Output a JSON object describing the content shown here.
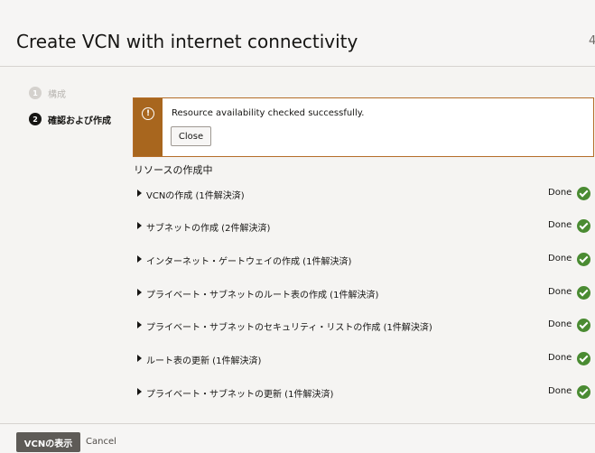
{
  "header": {
    "title": "Create VCN with internet connectivity",
    "cut_text": "4"
  },
  "steps": [
    {
      "number": "1",
      "label": "構成"
    },
    {
      "number": "2",
      "label": "確認および作成"
    }
  ],
  "alert": {
    "icon": "!",
    "message": "Resource availability checked successfully.",
    "close_label": "Close"
  },
  "section": {
    "title": "リソースの作成中"
  },
  "tasks": [
    {
      "name": "VCNの作成 (1件解決済)",
      "status": "Done"
    },
    {
      "name": "サブネットの作成 (2件解決済)",
      "status": "Done"
    },
    {
      "name": "インターネット・ゲートウェイの作成 (1件解決済)",
      "status": "Done"
    },
    {
      "name": "プライベート・サブネットのルート表の作成 (1件解決済)",
      "status": "Done"
    },
    {
      "name": "プライベート・サブネットのセキュリティ・リストの作成 (1件解決済)",
      "status": "Done"
    },
    {
      "name": "ルート表の更新 (1件解決済)",
      "status": "Done"
    },
    {
      "name": "プライベート・サブネットの更新 (1件解決済)",
      "status": "Done"
    }
  ],
  "footer": {
    "primary_label": "VCNの表示",
    "cancel_label": "Cancel"
  },
  "colors": {
    "warning": "#a8661e",
    "success": "#4a8b32",
    "primary_button": "#5e5b57"
  }
}
